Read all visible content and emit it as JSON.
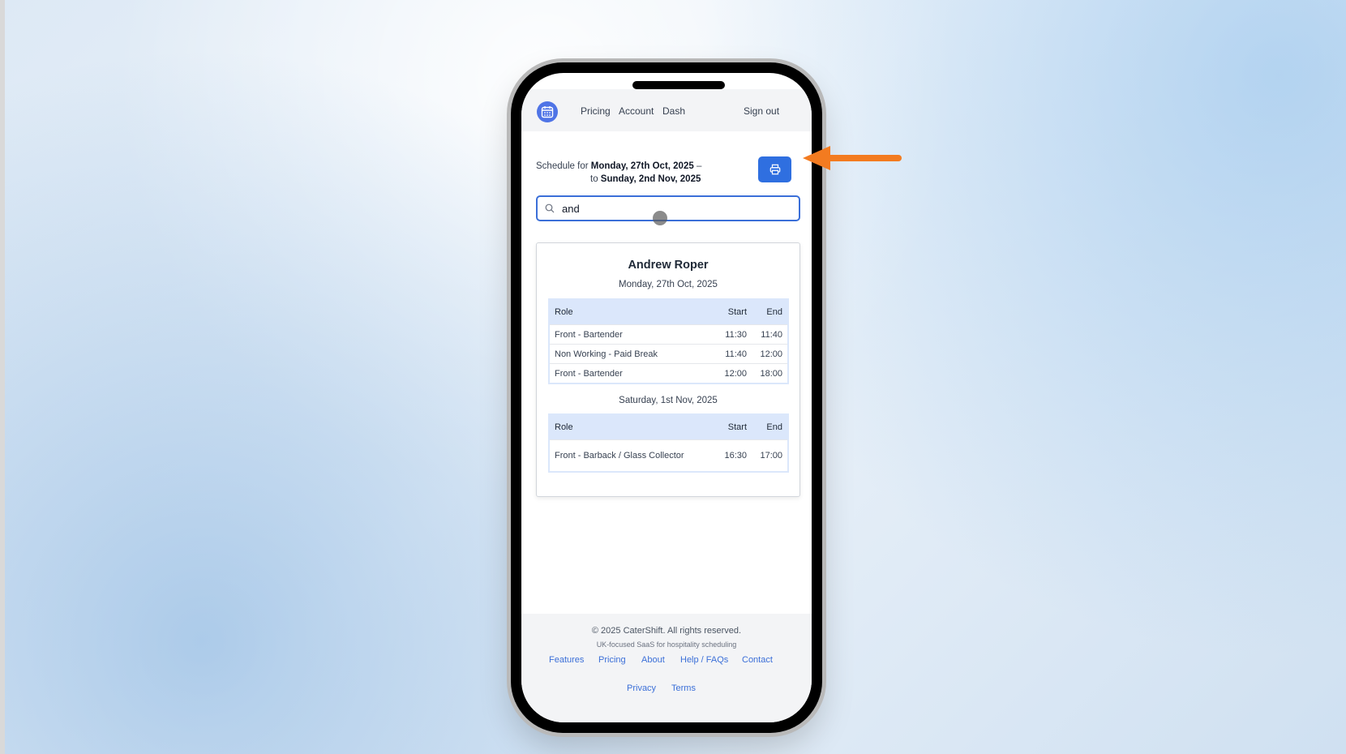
{
  "nav": {
    "logo_icon": "calendar-icon",
    "links": [
      "Pricing",
      "Account",
      "Dash"
    ],
    "signout": "Sign out"
  },
  "schedule": {
    "prefix": "Schedule for",
    "start_date": "Monday, 27th Oct, 2025",
    "dash": "–",
    "to": "to",
    "end_date": "Sunday, 2nd Nov, 2025"
  },
  "print_button": {
    "icon": "printer-icon"
  },
  "search": {
    "icon": "search-icon",
    "value": "and"
  },
  "result": {
    "name": "Andrew Roper",
    "days": [
      {
        "date": "Monday, 27th Oct, 2025",
        "headers": [
          "Role",
          "Start",
          "End"
        ],
        "rows": [
          [
            "Front - Bartender",
            "11:30",
            "11:40"
          ],
          [
            "Non Working - Paid Break",
            "11:40",
            "12:00"
          ],
          [
            "Front - Bartender",
            "12:00",
            "18:00"
          ]
        ]
      },
      {
        "date": "Saturday, 1st Nov, 2025",
        "headers": [
          "Role",
          "Start",
          "End"
        ],
        "rows": [
          [
            "Front - Barback / Glass Collector",
            "16:30",
            "17:00"
          ]
        ]
      }
    ]
  },
  "footer": {
    "copyright": "© 2025 CaterShift. All rights reserved.",
    "tagline": "UK-focused SaaS for hospitality scheduling",
    "links": [
      "Features",
      "Pricing",
      "About",
      "Help / FAQs",
      "Contact"
    ],
    "legal": [
      "Privacy",
      "Terms"
    ]
  },
  "colors": {
    "accent": "#2f6fe0",
    "annotation_arrow": "#f37b20",
    "table_header": "#dbe7fb"
  }
}
